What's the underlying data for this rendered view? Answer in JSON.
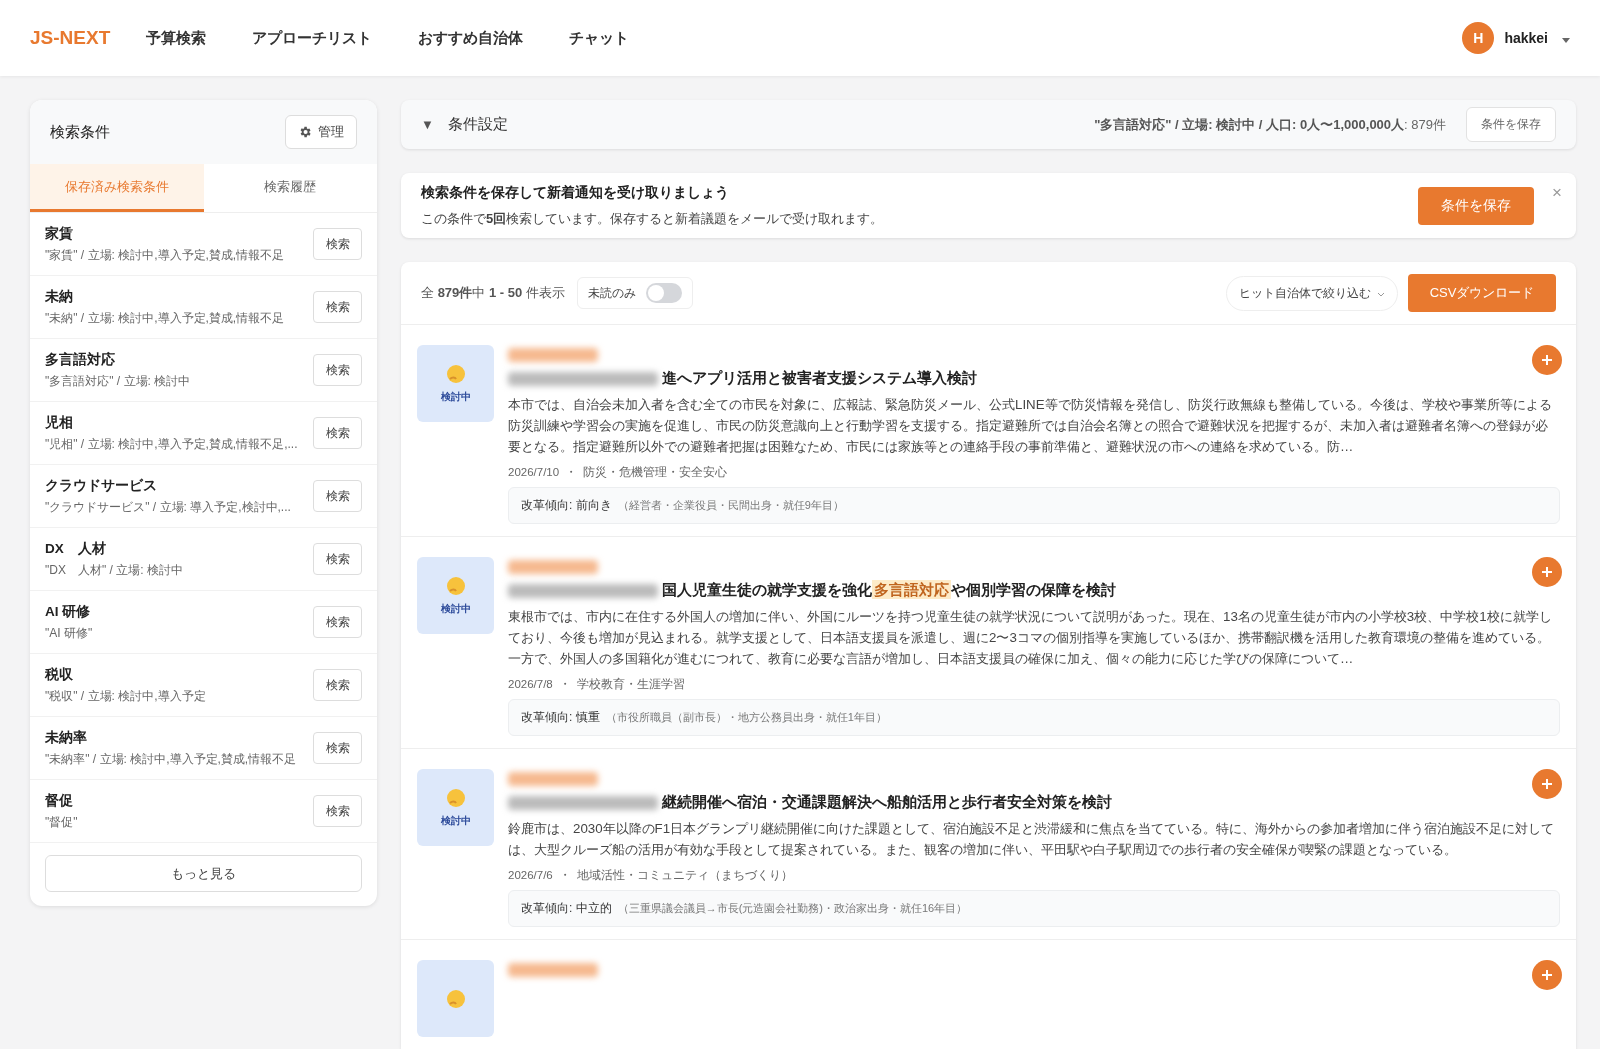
{
  "header": {
    "logo": "JS-NEXT",
    "nav": [
      {
        "label": "予算検索"
      },
      {
        "label": "アプローチリスト"
      },
      {
        "label": "おすすめ自治体"
      },
      {
        "label": "チャット"
      }
    ],
    "user": {
      "initial": "H",
      "name": "hakkei"
    }
  },
  "sidebar": {
    "title": "検索条件",
    "manage_button": "管理",
    "tabs": [
      {
        "label": "保存済み検索条件",
        "selected": true
      },
      {
        "label": "検索履歴",
        "selected": false
      }
    ],
    "items": [
      {
        "name": "家賃",
        "detail": "\"家賃\" / 立場: 検討中,導入予定,賛成,情報不足",
        "button": "検索"
      },
      {
        "name": "未納",
        "detail": "\"未納\" / 立場: 検討中,導入予定,賛成,情報不足",
        "button": "検索"
      },
      {
        "name": "多言語対応",
        "detail": "\"多言語対応\" / 立場: 検討中",
        "button": "検索"
      },
      {
        "name": "児相",
        "detail": "\"児相\" / 立場: 検討中,導入予定,賛成,情報不足,...",
        "button": "検索"
      },
      {
        "name": "クラウドサービス",
        "detail": "\"クラウドサービス\" / 立場: 導入予定,検討中,...",
        "button": "検索"
      },
      {
        "name": "DX　人材",
        "detail": "\"DX　人材\" / 立場: 検討中",
        "button": "検索"
      },
      {
        "name": "AI 研修",
        "detail": "\"AI 研修\"",
        "button": "検索"
      },
      {
        "name": "税収",
        "detail": "\"税収\" / 立場: 検討中,導入予定",
        "button": "検索"
      },
      {
        "name": "未納率",
        "detail": "\"未納率\" / 立場: 検討中,導入予定,賛成,情報不足",
        "button": "検索"
      },
      {
        "name": "督促",
        "detail": "\"督促\"",
        "button": "検索"
      }
    ],
    "more_button": "もっと見る"
  },
  "conditions": {
    "toggle": "▼",
    "title": "条件設定",
    "expanded": false,
    "summary": "**\"多言語対応\" / 立場: 検討中 / 人口: 0人〜1,000,000人**: 879件",
    "save_button": "条件を保存"
  },
  "banner": {
    "title": "検索条件を保存して新着通知を受け取りましょう",
    "text": "この条件で**5回**検索しています。保存すると新着議題をメールで受け取れます。",
    "save_button": "条件を保存",
    "close": "×"
  },
  "results": {
    "count": "全 **879件**中 **1 - 50** 件表示",
    "unread_toggle": {
      "label": "未読のみ",
      "on": false
    },
    "filter_dropdown": "ヒット自治体で絞り込む",
    "csv_button": "CSVダウンロード",
    "cards": [
      {
        "status": "検討中",
        "title": [
          {
            "text": "進へアプリ活用と被害者支援システム導入検討",
            "highlight": false
          }
        ],
        "body": "本市では、自治会未加入者を含む全ての市民を対象に、広報誌、緊急防災メール、公式LINE等で防災情報を発信し、防災行政無線も整備している。今後は、学校や事業所等による防災訓練や学習会の実施を促進し、市民の防災意識向上と行動学習を支援する。指定避難所では自治会名簿との照合で避難状況を把握するが、未加入者は避難者名簿への登録が必要となる。指定避難所以外での避難者把握は困難なため、市民には家族等との連絡手段の事前準備と、避難状況の市への連絡を求めている。防…",
        "date": "2026/7/10",
        "separator": "・",
        "category": "防災・危機管理・安全安心",
        "reform": "改革傾向: 前向き",
        "reform_detail": "（経営者・企業役員・民間出身・就任9年目）"
      },
      {
        "status": "検討中",
        "title": [
          {
            "text": "国人児童生徒の就学支援を強化",
            "highlight": false
          },
          {
            "text": "多言語対応",
            "highlight": true
          },
          {
            "text": "や個別学習の保障を検討",
            "highlight": false
          }
        ],
        "body": "東根市では、市内に在住する外国人の増加に伴い、外国にルーツを持つ児童生徒の就学状況について説明があった。現在、13名の児童生徒が市内の小学校3校、中学校1校に就学しており、今後も増加が見込まれる。就学支援として、日本語支援員を派遣し、週に2〜3コマの個別指導を実施しているほか、携帯翻訳機を活用した教育環境の整備を進めている。一方で、外国人の多国籍化が進むにつれて、教育に必要な言語が増加し、日本語支援員の確保に加え、個々の能力に応じた学びの保障について…",
        "date": "2026/7/8",
        "separator": "・",
        "category": "学校教育・生涯学習",
        "reform": "改革傾向: 慎重",
        "reform_detail": "（市役所職員（副市長）・地方公務員出身・就任1年目）"
      },
      {
        "status": "検討中",
        "title": [
          {
            "text": "継続開催へ宿泊・交通課題解決へ船舶活用と歩行者安全対策を検討",
            "highlight": false
          }
        ],
        "body": "鈴鹿市は、2030年以降のF1日本グランプリ継続開催に向けた課題として、宿泊施設不足と渋滞緩和に焦点を当てている。特に、海外からの参加者増加に伴う宿泊施設不足に対しては、大型クルーズ船の活用が有効な手段として提案されている。また、観客の増加に伴い、平田駅や白子駅周辺での歩行者の安全確保が喫緊の課題となっている。",
        "date": "2026/7/6",
        "separator": "・",
        "category": "地域活性・コミュニティ（まちづくり）",
        "reform": "改革傾向: 中立的",
        "reform_detail": "（三重県議会議員→市長(元造園会社勤務)・政治家出身・就任16年目）"
      }
    ],
    "partial_card": {
      "kind": "cut"
    }
  }
}
